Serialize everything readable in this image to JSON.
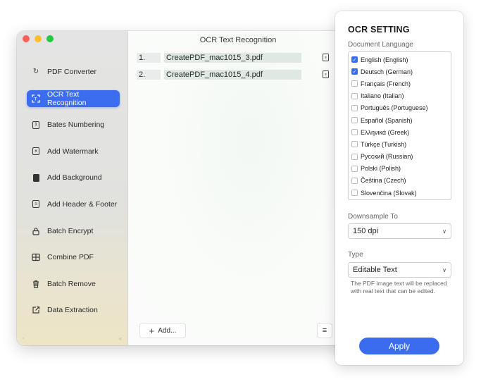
{
  "window": {
    "title": "OCR Text Recognition"
  },
  "sidebar": {
    "items": [
      {
        "label": "PDF Converter",
        "icon": "convert-icon",
        "active": false
      },
      {
        "label": "OCR Text Recognition",
        "icon": "scan-icon",
        "active": true
      },
      {
        "label": "Bates Numbering",
        "icon": "bates-icon",
        "active": false
      },
      {
        "label": "Add Watermark",
        "icon": "watermark-icon",
        "active": false
      },
      {
        "label": "Add Background",
        "icon": "background-icon",
        "active": false
      },
      {
        "label": "Add Header & Footer",
        "icon": "header-footer-icon",
        "active": false
      },
      {
        "label": "Batch Encrypt",
        "icon": "lock-icon",
        "active": false
      },
      {
        "label": "Combine PDF",
        "icon": "combine-icon",
        "active": false
      },
      {
        "label": "Batch Remove",
        "icon": "trash-icon",
        "active": false
      },
      {
        "label": "Data Extraction",
        "icon": "extract-icon",
        "active": false
      }
    ],
    "bottom_left": "‹",
    "bottom_right": "«"
  },
  "files": [
    {
      "num": "1.",
      "name": "CreatePDF_mac1015_3.pdf"
    },
    {
      "num": "2.",
      "name": "CreatePDF_mac1015_4.pdf"
    }
  ],
  "toolbar": {
    "add_label": "Add...",
    "add_icon": "plus-icon",
    "list_icon": "menu-icon"
  },
  "ocr": {
    "title": "OCR SETTING",
    "doc_lang_label": "Document Language",
    "languages": [
      {
        "label": "English (English)",
        "checked": true
      },
      {
        "label": "Deutsch (German)",
        "checked": true
      },
      {
        "label": "Français (French)",
        "checked": false
      },
      {
        "label": "Italiano (Italian)",
        "checked": false
      },
      {
        "label": "Português (Portuguese)",
        "checked": false
      },
      {
        "label": "Español (Spanish)",
        "checked": false
      },
      {
        "label": "Ελληνικά (Greek)",
        "checked": false
      },
      {
        "label": "Türkçe (Turkish)",
        "checked": false
      },
      {
        "label": "Русский (Russian)",
        "checked": false
      },
      {
        "label": "Polski (Polish)",
        "checked": false
      },
      {
        "label": "Čeština (Czech)",
        "checked": false
      },
      {
        "label": "Slovenčina (Slovak)",
        "checked": false
      }
    ],
    "downsample_label": "Downsample To",
    "downsample_value": "150 dpi",
    "type_label": "Type",
    "type_value": "Editable Text",
    "type_description": "The PDF image text will be replaced with real text that can be edited.",
    "apply_label": "Apply"
  },
  "colors": {
    "accent": "#3c6cf0",
    "close": "#ff5f57",
    "minimize": "#febc2e",
    "zoom": "#28c840"
  }
}
